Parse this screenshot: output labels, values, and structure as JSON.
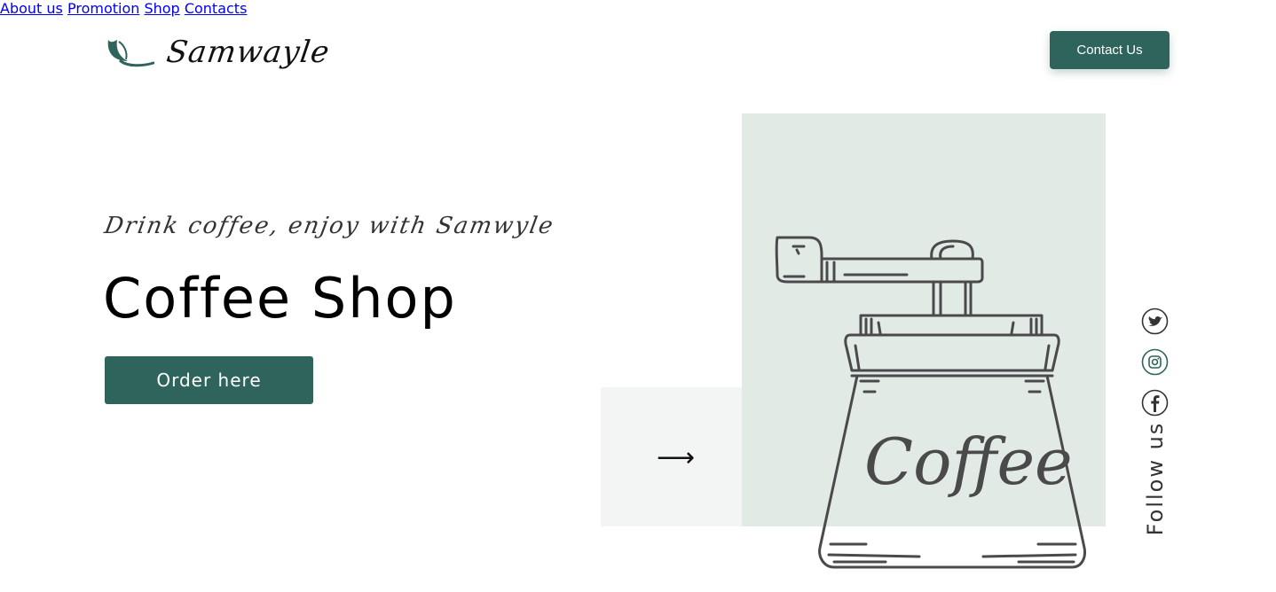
{
  "brand": {
    "name": "Samwayle",
    "accent": "#2e645c"
  },
  "nav": {
    "items": [
      "About us",
      "Promotion",
      "Shop",
      "Contacts"
    ],
    "cta": "Contact Us"
  },
  "hero": {
    "tagline": "Drink coffee, enjoy with Samwyle",
    "title": "Coffee Shop",
    "button": "Order here",
    "arrow": "⟶",
    "illustration_text": "Coffee"
  },
  "social": {
    "icons": [
      "twitter-icon",
      "instagram-icon",
      "facebook-icon"
    ],
    "label": "Follow us"
  },
  "colors": {
    "panel_green": "#e2eae6",
    "panel_light": "#f3f5f4",
    "line": "#4a4a4a"
  }
}
